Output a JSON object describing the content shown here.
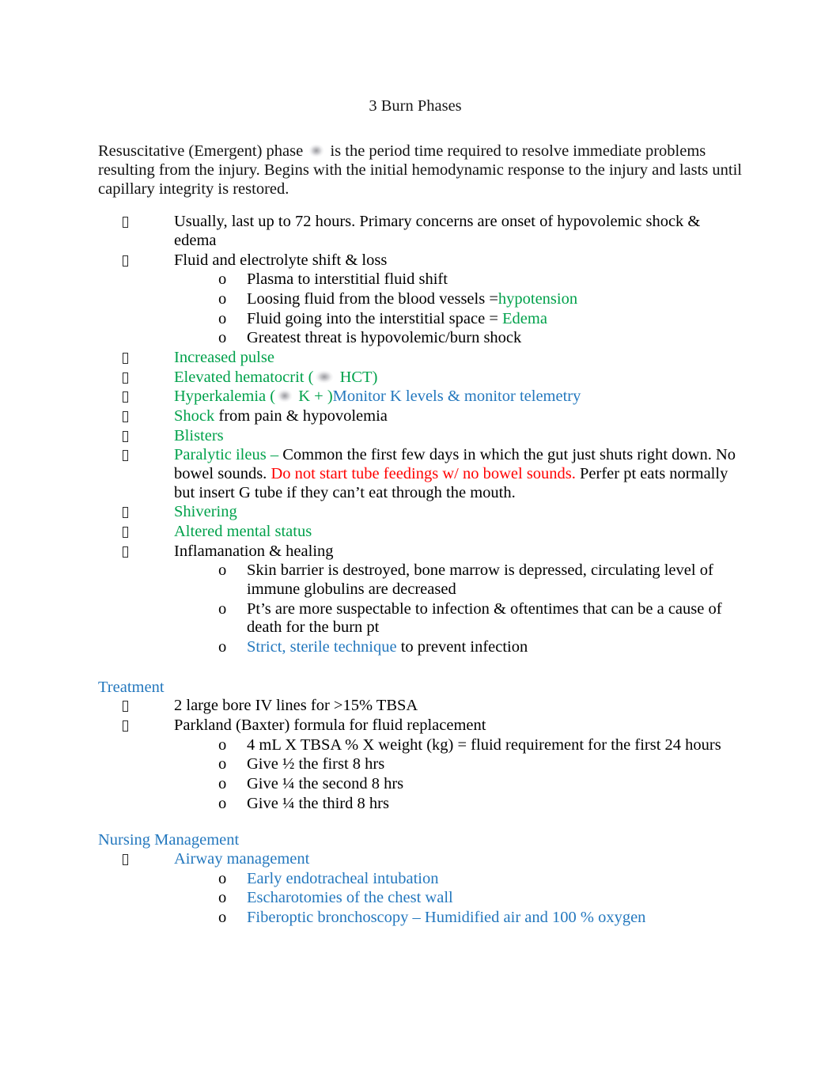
{
  "document": {
    "title": "3 Burn Phases",
    "colors": {
      "green": "#00A14B",
      "blue": "#2478BE",
      "red": "#FF0000",
      "black": "#000000"
    },
    "intro": {
      "before_blob": "Resuscitative (Emergent) phase ",
      "after_blob": " is the period time required to resolve immediate problems resulting from the injury. Begins with the initial hemodynamic response to the injury and lasts until capillary integrity is restored."
    },
    "bullets": [
      {
        "marker": "tofu",
        "text": "Usually, last up to 72 hours. Primary concerns are onset of hypovolemic shock & edema"
      },
      {
        "marker": "tofu",
        "text": "Fluid and electrolyte shift & loss"
      },
      {
        "marker": "o",
        "text": "Plasma to interstitial fluid shift"
      },
      {
        "marker": "o",
        "text_black": "Loosing fluid from the blood vessels =",
        "text_green": "hypotension"
      },
      {
        "marker": "o",
        "text_black": "Fluid going into the interstitial space = ",
        "text_green": "Edema"
      },
      {
        "marker": "o",
        "text": "Greatest threat is  hypovolemic/burn shock"
      },
      {
        "marker": "tofu",
        "text_green": "Increased pulse"
      },
      {
        "marker": "tofu",
        "text_green_a": "Elevated hematocrit (",
        "text_green_b": " HCT)"
      },
      {
        "marker": "tofu",
        "text_green_a": "Hyperkalemia (",
        "text_green_b": " K + )",
        "text_blue": "Monitor K levels & monitor telemetry"
      },
      {
        "marker": "tofu",
        "text_green": "Shock",
        "text_black": " from pain & hypovolemia"
      },
      {
        "marker": "tofu",
        "text_green": "Blisters"
      },
      {
        "marker": "tofu",
        "text_green": "Paralytic ileus –",
        "text_black_1": " Common the first few days in which the gut just shuts right down. No bowel sounds.  ",
        "text_red": "Do not start tube feedings w/ no bowel sounds.",
        "text_black_2": "   Perfer pt eats normally but insert G tube if they can’t eat through the mouth."
      },
      {
        "marker": "tofu",
        "text_green": "Shivering"
      },
      {
        "marker": "tofu",
        "text_green": "Altered mental status"
      },
      {
        "marker": "tofu",
        "text": "Inflamanation & healing"
      },
      {
        "marker": "o",
        "text": "Skin barrier is destroyed, bone marrow is depressed, circulating level of immune globulins are decreased"
      },
      {
        "marker": "o",
        "text": "Pt’s are more suspectable to infection & oftentimes that can be a cause of death for the burn pt"
      },
      {
        "marker": "o",
        "text_blue": "Strict, sterile technique",
        "text_black": " to prevent infection"
      }
    ],
    "treatment": {
      "heading": "Treatment",
      "items": [
        {
          "marker": "tofu",
          "text": "2 large bore IV lines for >15% TBSA"
        },
        {
          "marker": "tofu",
          "text": "Parkland (Baxter) formula for fluid replacement"
        },
        {
          "marker": "o",
          "text": "4 mL X TBSA % X weight (kg) = fluid requirement for the first 24 hours"
        },
        {
          "marker": "o",
          "text": "Give ½ the first 8 hrs"
        },
        {
          "marker": "o",
          "text": "Give ¼ the second 8 hrs"
        },
        {
          "marker": "o",
          "text": "Give ¼ the third 8 hrs"
        }
      ]
    },
    "nursing": {
      "heading": "Nursing Management",
      "items": [
        {
          "marker": "tofu",
          "text": "Airway management"
        },
        {
          "marker": "o",
          "text": "Early endotracheal intubation"
        },
        {
          "marker": "o",
          "text": "Escharotomies of the chest wall"
        },
        {
          "marker": "o",
          "text": "Fiberoptic bronchoscopy – Humidified air and 100 % oxygen"
        }
      ]
    },
    "markers": {
      "sub_bullet": "o"
    }
  }
}
